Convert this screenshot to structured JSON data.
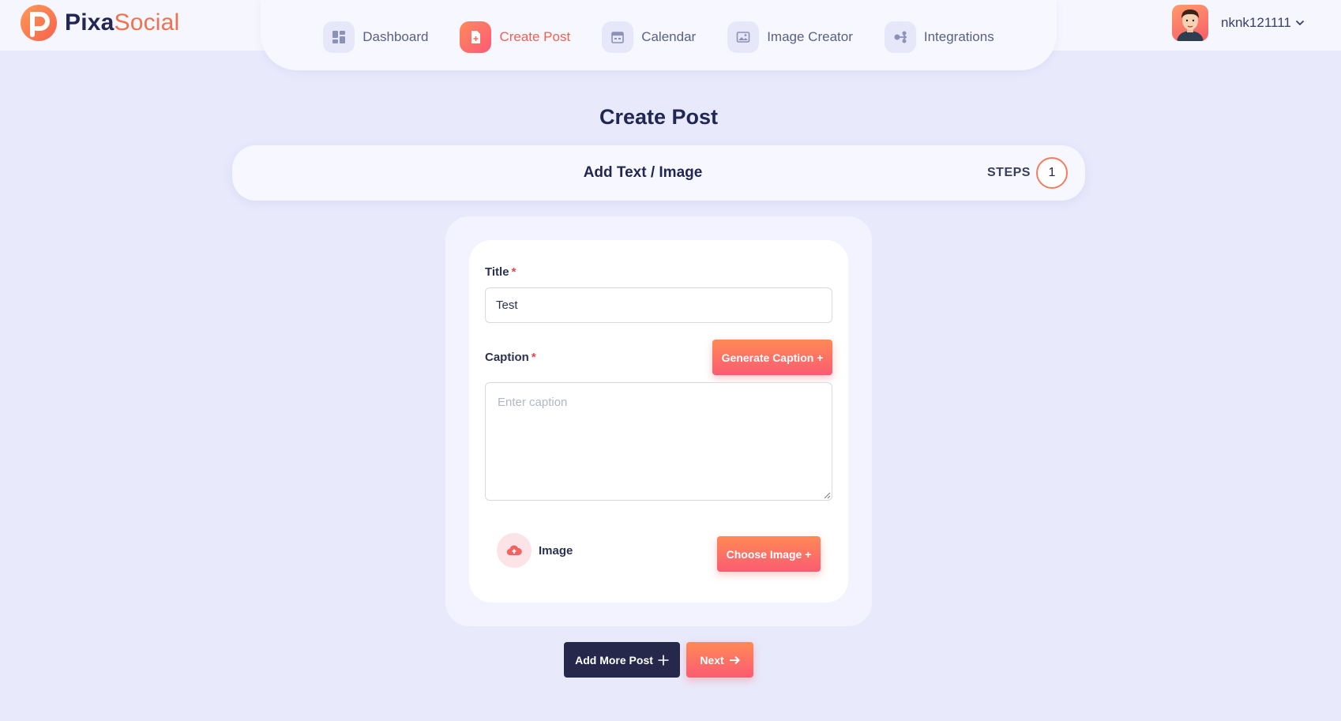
{
  "brand": {
    "name_part1": "Pixa",
    "name_part2": "Social"
  },
  "nav": {
    "items": [
      {
        "label": "Dashboard",
        "icon": "dashboard-icon",
        "active": false
      },
      {
        "label": "Create Post",
        "icon": "create-post-icon",
        "active": true
      },
      {
        "label": "Calendar",
        "icon": "calendar-icon",
        "active": false
      },
      {
        "label": "Image Creator",
        "icon": "image-icon",
        "active": false
      },
      {
        "label": "Integrations",
        "icon": "integrations-icon",
        "active": false
      }
    ]
  },
  "user": {
    "name": "nknk121111"
  },
  "page": {
    "title": "Create Post"
  },
  "steps": {
    "title": "Add Text / Image",
    "label": "STEPS",
    "current": "1"
  },
  "form": {
    "title_label": "Title",
    "title_value": "Test",
    "required_mark": "*",
    "caption_label": "Caption",
    "caption_placeholder": "Enter caption",
    "generate_caption_label": "Generate Caption +",
    "image_label": "Image",
    "choose_image_label": "Choose Image +"
  },
  "actions": {
    "add_more_label": "Add More Post",
    "next_label": "Next"
  },
  "colors": {
    "accent": "#f2604f",
    "dark": "#25284a",
    "background": "#e8e9fb"
  }
}
